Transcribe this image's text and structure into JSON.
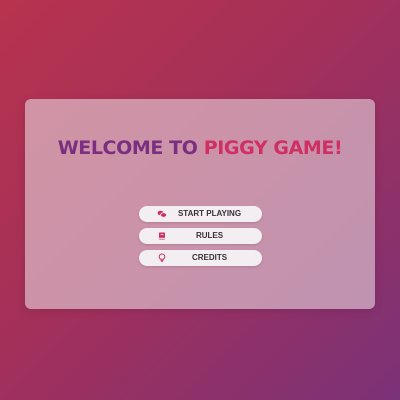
{
  "title": {
    "part1": "WELCOME TO",
    "part2": "PIGGY GAME!"
  },
  "menu": {
    "items": [
      {
        "label": "START PLAYING",
        "icon": "coins-icon"
      },
      {
        "label": "RULES",
        "icon": "book-icon"
      },
      {
        "label": "CREDITS",
        "icon": "lightbulb-icon"
      }
    ]
  },
  "colors": {
    "title_primary": "#7a2f80",
    "title_accent": "#cf2f63",
    "icon": "#cf2f63",
    "background_start": "#b8334e",
    "background_end": "#7b3277"
  }
}
